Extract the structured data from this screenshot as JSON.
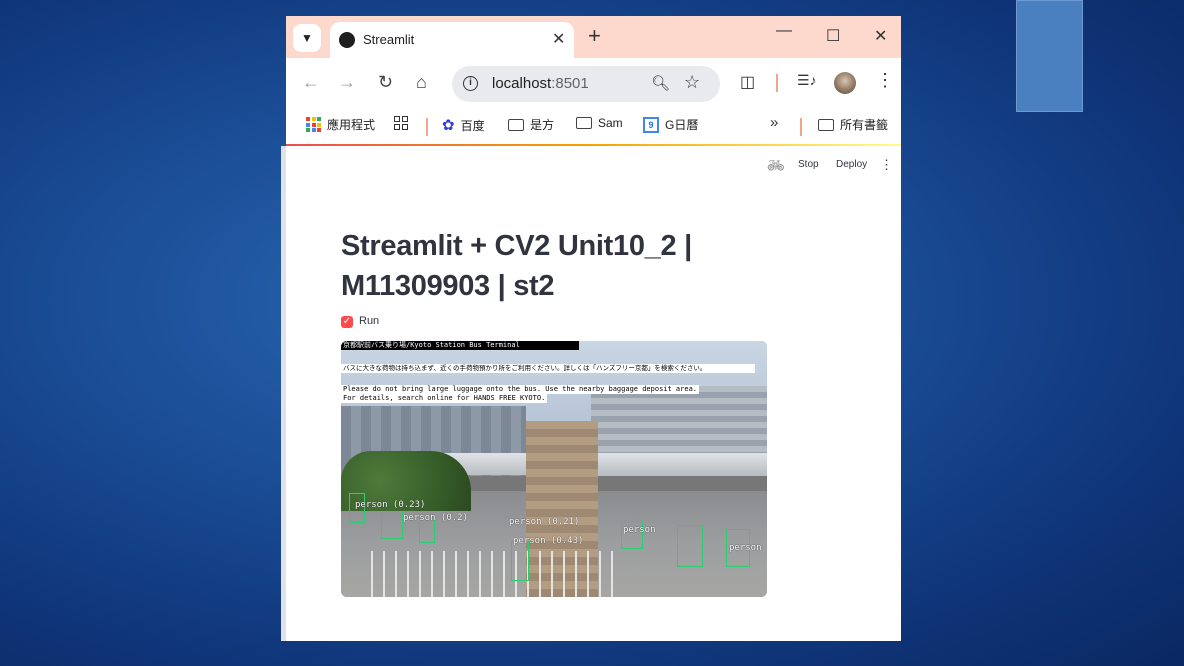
{
  "browser": {
    "tab_title": "Streamlit",
    "url_host": "localhost",
    "url_port": ":8501"
  },
  "bookmarks": [
    {
      "label": "應用程式",
      "icon": "apps-grid-icon"
    },
    {
      "label": "",
      "icon": "grid-icon"
    },
    {
      "label": "百度",
      "icon": "baidu-paw-icon"
    },
    {
      "label": "是方",
      "icon": "folder-icon"
    },
    {
      "label": "Sam",
      "icon": "folder-icon"
    },
    {
      "label": "G日曆",
      "icon": "google-calendar-icon"
    },
    {
      "label": "所有書籤",
      "icon": "folder-icon"
    }
  ],
  "streamlit": {
    "stop_label": "Stop",
    "deploy_label": "Deploy",
    "title_line1": "Streamlit + CV2 Unit10_2 |",
    "title_line2": "M11309903 | st2",
    "checkbox_label": "Run",
    "checkbox_checked": true
  },
  "video": {
    "caption_top": "京都駅前バス乗り場/Kyoto Station Bus Terminal",
    "caption_jp": "バスに大きな荷物は持ち込まず、近くの手荷物預かり所をご利用ください。詳しくは「ハンズフリー京都」を検索ください。",
    "caption_en1": "Please do not bring large luggage onto the bus. Use the nearby baggage deposit area.",
    "caption_en2": " For details, search online for HANDS FREE KYOTO.",
    "detections": [
      {
        "label": "person (0.23)"
      },
      {
        "label": "person (0.2)"
      },
      {
        "label": "person (0.21)"
      },
      {
        "label": "person (0.43)"
      },
      {
        "label": "person"
      },
      {
        "label": "person"
      }
    ]
  },
  "colors": {
    "tab_bar": "#fcd9cc",
    "streamlit_red": "#ff4b4b",
    "detection_box": "#2ecc71"
  }
}
